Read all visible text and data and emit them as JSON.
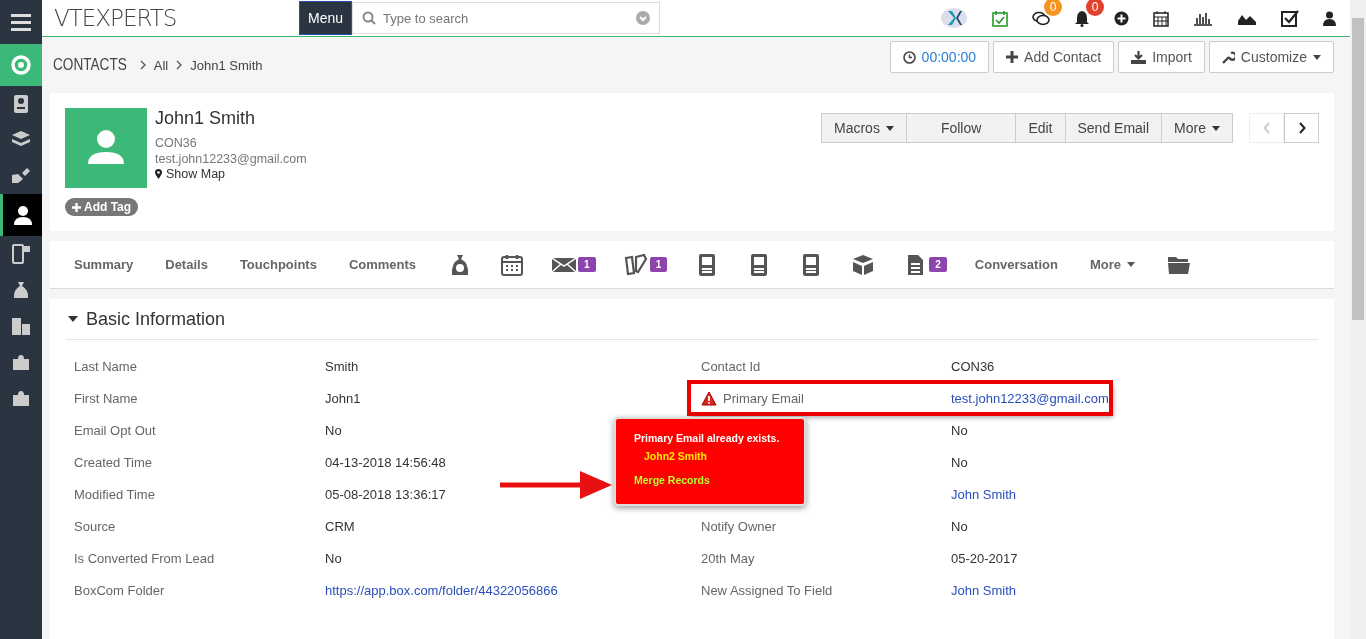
{
  "header": {
    "logo": "VTEXPERTS",
    "menu_button": "Menu",
    "search": {
      "placeholder": "Type to search"
    },
    "badges": [
      {
        "text": "0",
        "color": "#f7941d"
      },
      {
        "text": "0",
        "color": "#e2412c"
      }
    ]
  },
  "sidebar": {
    "items": [
      {
        "selected": false
      },
      {
        "selected": false
      },
      {
        "selected": false
      },
      {
        "selected": false
      },
      {
        "selected": false
      },
      {
        "selected": true
      },
      {
        "selected": false
      },
      {
        "selected": false
      },
      {
        "selected": false
      },
      {
        "selected": false
      },
      {
        "selected": false
      }
    ]
  },
  "breadcrumb": {
    "module": "CONTACTS",
    "items": [
      "All",
      "John1 Smith"
    ]
  },
  "page_actions": [
    {
      "kind": "timer",
      "label": "00:00:00"
    },
    {
      "kind": "add",
      "label": "Add Contact"
    },
    {
      "kind": "import",
      "label": "Import"
    },
    {
      "kind": "customize",
      "label": "Customize"
    }
  ],
  "record": {
    "name": "John1 Smith",
    "id": "CON36",
    "email": "test.john12233@gmail.com",
    "map_link": "Show Map",
    "add_tag": "Add Tag",
    "actions": [
      {
        "label": "Macros",
        "dropdown": true
      },
      {
        "label": "Follow",
        "dropdown": false
      },
      {
        "label": "Edit",
        "dropdown": false
      },
      {
        "label": "Send Email",
        "dropdown": false
      },
      {
        "label": "More",
        "dropdown": true
      }
    ],
    "pager": {
      "previous_disabled": true,
      "next_disabled": false
    }
  },
  "tabs": [
    {
      "kind": "text",
      "label": "Summary"
    },
    {
      "kind": "text",
      "label": "Details"
    },
    {
      "kind": "text",
      "label": "Touchpoints"
    },
    {
      "kind": "text",
      "label": "Comments"
    },
    {
      "kind": "icon"
    },
    {
      "kind": "icon"
    },
    {
      "kind": "icon",
      "badge": "1"
    },
    {
      "kind": "icon",
      "badge": "1"
    },
    {
      "kind": "icon"
    },
    {
      "kind": "icon"
    },
    {
      "kind": "icon"
    },
    {
      "kind": "icon"
    },
    {
      "kind": "icon",
      "badge": "2"
    },
    {
      "kind": "text",
      "label": "Conversation"
    },
    {
      "kind": "dropdown",
      "label": "More"
    },
    {
      "kind": "icon"
    }
  ],
  "section": {
    "title": "Basic Information",
    "expanded": true,
    "left": [
      {
        "label": "Last Name",
        "value": "Smith",
        "link": false
      },
      {
        "label": "First Name",
        "value": "John1",
        "link": false
      },
      {
        "label": "Email Opt Out",
        "value": "No",
        "link": false
      },
      {
        "label": "Created Time",
        "value": "04-13-2018 14:56:48",
        "link": false
      },
      {
        "label": "Modified Time",
        "value": "05-08-2018 13:36:17",
        "link": false
      },
      {
        "label": "Source",
        "value": "CRM",
        "link": false
      },
      {
        "label": "Is Converted From Lead",
        "value": "No",
        "link": false
      },
      {
        "label": "BoxCom Folder",
        "value": "https://app.box.com/folder/44322056866",
        "link": true
      }
    ],
    "right": [
      {
        "label": "Contact Id",
        "value": "CON36",
        "link": false,
        "warning": false
      },
      {
        "label": "Primary Email",
        "value": "test.john12233@gmail.com",
        "link": true,
        "warning": true
      },
      {
        "value": "No",
        "link": false,
        "warning": false
      },
      {
        "value": "No",
        "link": false,
        "warning": false
      },
      {
        "value": "John Smith",
        "link": true,
        "warning": false
      },
      {
        "label": "Notify Owner",
        "value": "No",
        "link": false,
        "warning": false
      },
      {
        "label": "20th May",
        "value": "05-20-2017",
        "link": false,
        "warning": false
      },
      {
        "label": "New Assigned To Field",
        "value": "John Smith",
        "link": true,
        "warning": false
      }
    ]
  },
  "duplicate_popup": {
    "message": "Primary Email already exists.",
    "record": "John2 Smith",
    "action": "Merge Records"
  }
}
